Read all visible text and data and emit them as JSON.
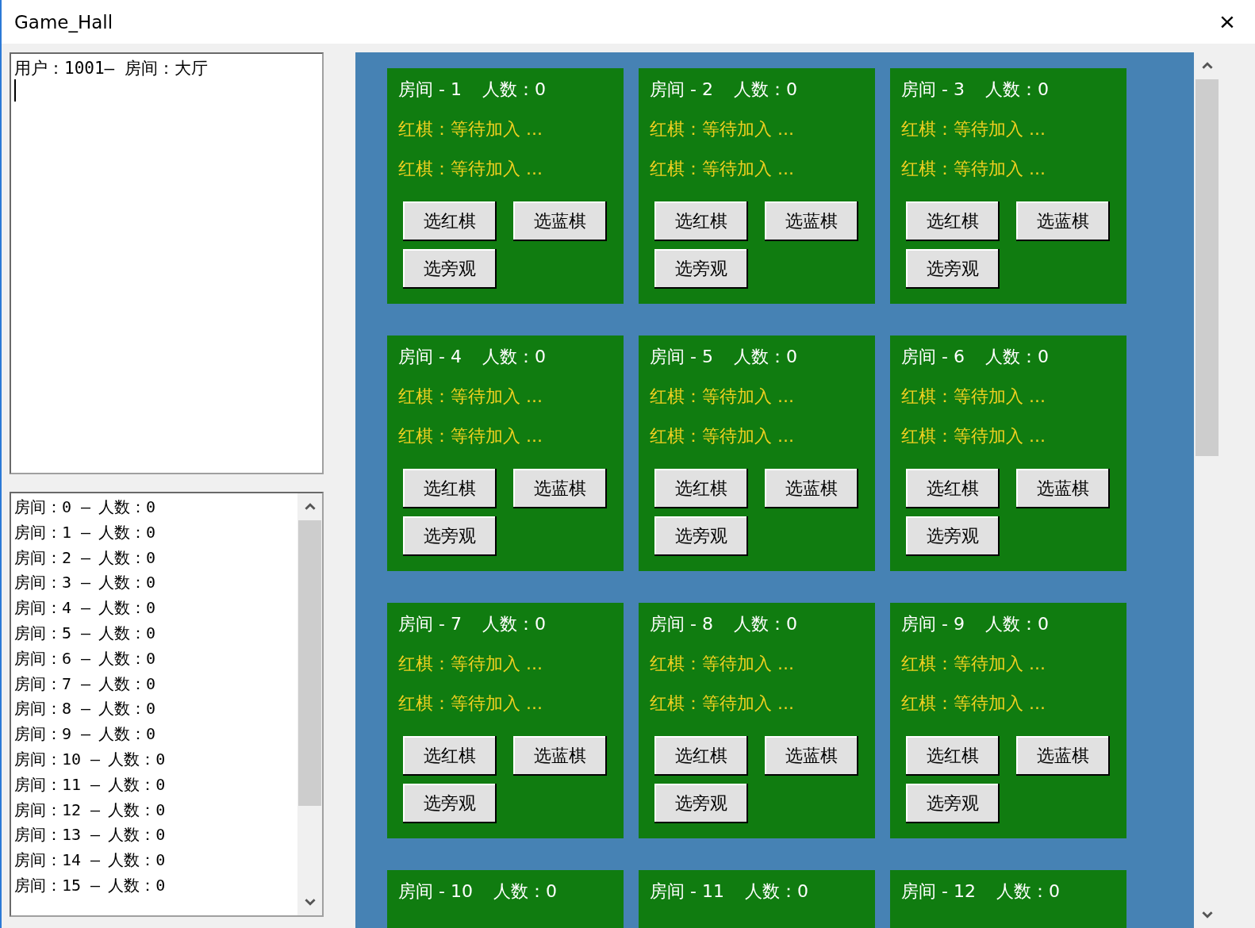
{
  "window": {
    "title": "Game_Hall",
    "close": "×"
  },
  "log": {
    "lines": [
      "用户：1001— 房间：大厅"
    ]
  },
  "room_list": [
    {
      "room": "房间：0",
      "dash": "—",
      "count": "人数：0"
    },
    {
      "room": "房间：1",
      "dash": "—",
      "count": "人数：0"
    },
    {
      "room": "房间：2",
      "dash": "—",
      "count": "人数：0"
    },
    {
      "room": "房间：3",
      "dash": "—",
      "count": "人数：0"
    },
    {
      "room": "房间：4",
      "dash": "—",
      "count": "人数：0"
    },
    {
      "room": "房间：5",
      "dash": "—",
      "count": "人数：0"
    },
    {
      "room": "房间：6",
      "dash": "—",
      "count": "人数：0"
    },
    {
      "room": "房间：7",
      "dash": "—",
      "count": "人数：0"
    },
    {
      "room": "房间：8",
      "dash": "—",
      "count": "人数：0"
    },
    {
      "room": "房间：9",
      "dash": "—",
      "count": "人数：0"
    },
    {
      "room": "房间：10",
      "dash": "—",
      "count": "人数：0"
    },
    {
      "room": "房间：11",
      "dash": "—",
      "count": "人数：0"
    },
    {
      "room": "房间：12",
      "dash": "—",
      "count": "人数：0"
    },
    {
      "room": "房间：13",
      "dash": "—",
      "count": "人数：0"
    },
    {
      "room": "房间：14",
      "dash": "—",
      "count": "人数：0"
    },
    {
      "room": "房间：15",
      "dash": "—",
      "count": "人数：0"
    }
  ],
  "rooms": [
    {
      "title": "房间 - 1",
      "count": "人数：0",
      "players": [
        "红棋：等待加入 ...",
        "红棋：等待加入 ..."
      ],
      "buttons": [
        "选红棋",
        "选蓝棋",
        "选旁观"
      ]
    },
    {
      "title": "房间 - 2",
      "count": "人数：0",
      "players": [
        "红棋：等待加入 ...",
        "红棋：等待加入 ..."
      ],
      "buttons": [
        "选红棋",
        "选蓝棋",
        "选旁观"
      ]
    },
    {
      "title": "房间 - 3",
      "count": "人数：0",
      "players": [
        "红棋：等待加入 ...",
        "红棋：等待加入 ..."
      ],
      "buttons": [
        "选红棋",
        "选蓝棋",
        "选旁观"
      ]
    },
    {
      "title": "房间 - 4",
      "count": "人数：0",
      "players": [
        "红棋：等待加入 ...",
        "红棋：等待加入 ..."
      ],
      "buttons": [
        "选红棋",
        "选蓝棋",
        "选旁观"
      ]
    },
    {
      "title": "房间 - 5",
      "count": "人数：0",
      "players": [
        "红棋：等待加入 ...",
        "红棋：等待加入 ..."
      ],
      "buttons": [
        "选红棋",
        "选蓝棋",
        "选旁观"
      ]
    },
    {
      "title": "房间 - 6",
      "count": "人数：0",
      "players": [
        "红棋：等待加入 ...",
        "红棋：等待加入 ..."
      ],
      "buttons": [
        "选红棋",
        "选蓝棋",
        "选旁观"
      ]
    },
    {
      "title": "房间 - 7",
      "count": "人数：0",
      "players": [
        "红棋：等待加入 ...",
        "红棋：等待加入 ..."
      ],
      "buttons": [
        "选红棋",
        "选蓝棋",
        "选旁观"
      ]
    },
    {
      "title": "房间 - 8",
      "count": "人数：0",
      "players": [
        "红棋：等待加入 ...",
        "红棋：等待加入 ..."
      ],
      "buttons": [
        "选红棋",
        "选蓝棋",
        "选旁观"
      ]
    },
    {
      "title": "房间 - 9",
      "count": "人数：0",
      "players": [
        "红棋：等待加入 ...",
        "红棋：等待加入 ..."
      ],
      "buttons": [
        "选红棋",
        "选蓝棋",
        "选旁观"
      ]
    },
    {
      "title": "房间 - 10",
      "count": "人数：0"
    },
    {
      "title": "房间 - 11",
      "count": "人数：0"
    },
    {
      "title": "房间 - 12",
      "count": "人数：0"
    }
  ]
}
